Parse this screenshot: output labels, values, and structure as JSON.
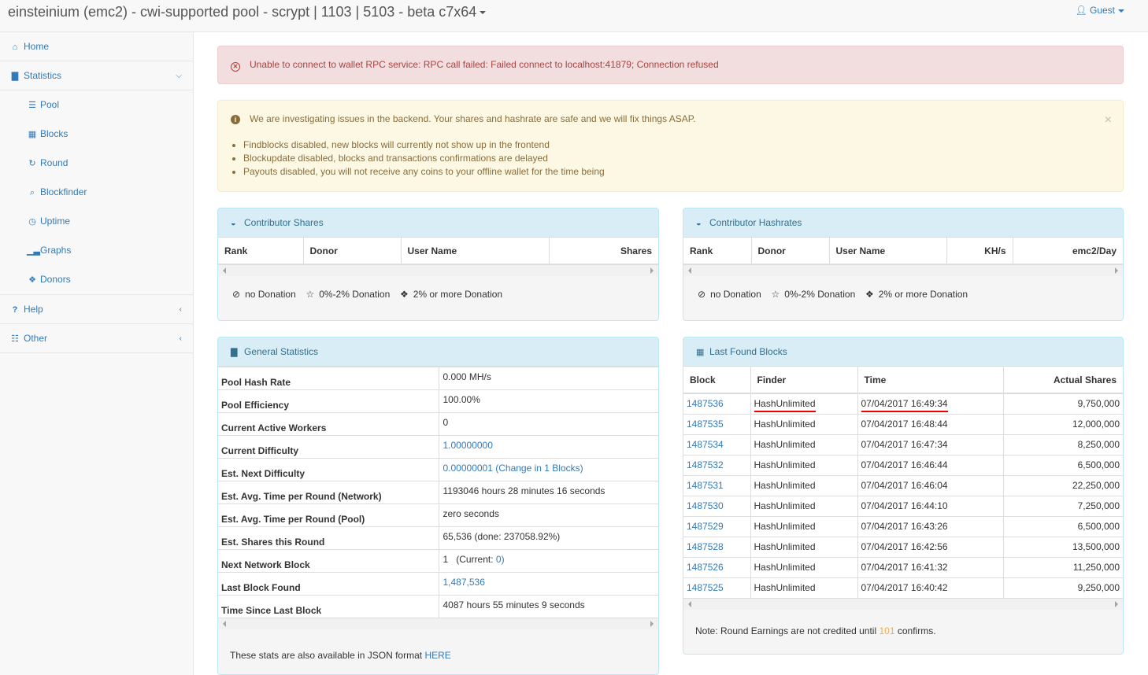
{
  "header": {
    "title": "einsteinium (emc2) - cwi-supported pool - scrypt | 1103 | 5103 - beta c7x64",
    "user_label": "Guest"
  },
  "sidebar": {
    "home": "Home",
    "statistics": "Statistics",
    "sub": [
      "Pool",
      "Blocks",
      "Round",
      "Blockfinder",
      "Uptime",
      "Graphs",
      "Donors"
    ],
    "help": "Help",
    "other": "Other"
  },
  "alerts": {
    "error": "Unable to connect to wallet RPC service: RPC call failed: Failed connect to localhost:41879; Connection refused",
    "warning_title": "We are investigating issues in the backend. Your shares and hashrate are safe and we will fix things ASAP.",
    "warning_items": [
      "Findblocks disabled, new blocks will currently not show up in the frontend",
      "Blockupdate disabled, blocks and transactions confirmations are delayed",
      "Payouts disabled, you will not receive any coins to your offline wallet for the time being"
    ]
  },
  "contributor_shares": {
    "title": "Contributor Shares",
    "columns": [
      "Rank",
      "Donor",
      "User Name",
      "Shares"
    ],
    "legend": [
      "no Donation",
      "0%-2% Donation",
      "2% or more Donation"
    ]
  },
  "contributor_hashrates": {
    "title": "Contributor Hashrates",
    "columns": [
      "Rank",
      "Donor",
      "User Name",
      "KH/s",
      "emc2/Day"
    ],
    "legend": [
      "no Donation",
      "0%-2% Donation",
      "2% or more Donation"
    ]
  },
  "general_stats": {
    "title": "General Statistics",
    "rows": [
      {
        "k": "Pool Hash Rate",
        "v": "0.000 MH/s"
      },
      {
        "k": "Pool Efficiency",
        "v": "100.00%"
      },
      {
        "k": "Current Active Workers",
        "v": "0"
      },
      {
        "k": "Current Difficulty",
        "v": "1.00000000"
      },
      {
        "k": "Est. Next Difficulty",
        "v": "0.00000001 (Change in 1 Blocks)"
      },
      {
        "k": "Est. Avg. Time per Round (Network)",
        "v": "1193046 hours 28 minutes 16 seconds"
      },
      {
        "k": "Est. Avg. Time per Round (Pool)",
        "v": "zero seconds"
      },
      {
        "k": "Est. Shares this Round",
        "v": "65,536 (done: 237058.92%)"
      },
      {
        "k": "Next Network Block",
        "v": "1",
        "v2": "(Current:",
        "v3": "0)"
      },
      {
        "k": "Last Block Found",
        "v": "1,487,536"
      },
      {
        "k": "Time Since Last Block",
        "v": "4087 hours 55 minutes 9 seconds"
      }
    ],
    "footer_text": "These stats are also available in JSON format",
    "footer_link": "HERE"
  },
  "last_found_blocks": {
    "title": "Last Found Blocks",
    "columns": [
      "Block",
      "Finder",
      "Time",
      "Actual Shares"
    ],
    "rows": [
      {
        "block": "1487536",
        "finder": "HashUnlimited",
        "time": "07/04/2017 16:49:34",
        "shares": "9,750,000"
      },
      {
        "block": "1487535",
        "finder": "HashUnlimited",
        "time": "07/04/2017 16:48:44",
        "shares": "12,000,000"
      },
      {
        "block": "1487534",
        "finder": "HashUnlimited",
        "time": "07/04/2017 16:47:34",
        "shares": "8,250,000"
      },
      {
        "block": "1487532",
        "finder": "HashUnlimited",
        "time": "07/04/2017 16:46:44",
        "shares": "6,500,000"
      },
      {
        "block": "1487531",
        "finder": "HashUnlimited",
        "time": "07/04/2017 16:46:04",
        "shares": "22,250,000"
      },
      {
        "block": "1487530",
        "finder": "HashUnlimited",
        "time": "07/04/2017 16:44:10",
        "shares": "7,250,000"
      },
      {
        "block": "1487529",
        "finder": "HashUnlimited",
        "time": "07/04/2017 16:43:26",
        "shares": "6,500,000"
      },
      {
        "block": "1487528",
        "finder": "HashUnlimited",
        "time": "07/04/2017 16:42:56",
        "shares": "13,500,000"
      },
      {
        "block": "1487526",
        "finder": "HashUnlimited",
        "time": "07/04/2017 16:41:32",
        "shares": "11,250,000"
      },
      {
        "block": "1487525",
        "finder": "HashUnlimited",
        "time": "07/04/2017 16:40:42",
        "shares": "9,250,000"
      }
    ],
    "note_prefix": "Note: Round Earnings are not credited until",
    "note_count": "101",
    "note_suffix": "confirms."
  }
}
